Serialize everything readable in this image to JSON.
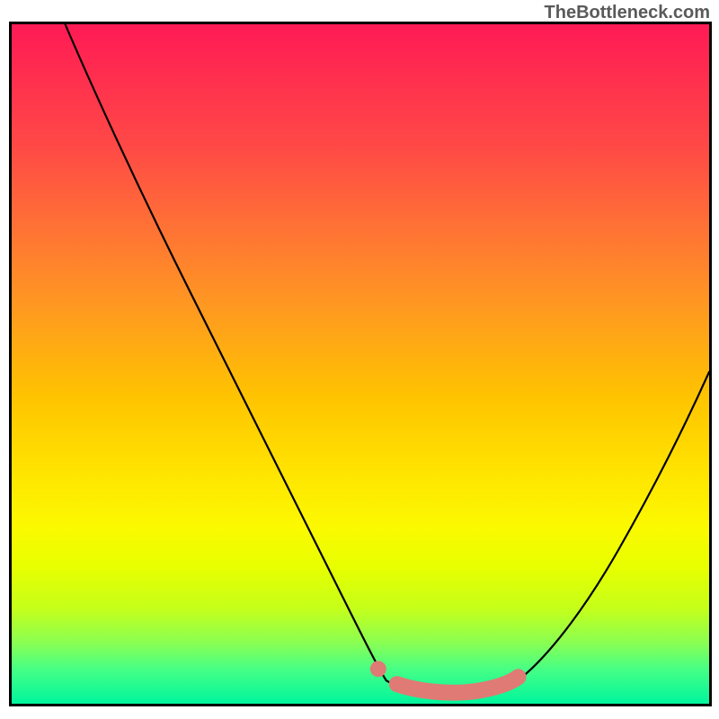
{
  "watermark": "TheBottleneck.com",
  "chart_data": {
    "type": "line",
    "title": "",
    "xlabel": "",
    "ylabel": "",
    "xlim": [
      0,
      100
    ],
    "ylim": [
      0,
      100
    ],
    "series": [
      {
        "name": "curve-main",
        "x": [
          8,
          12,
          20,
          30,
          40,
          48,
          52,
          55,
          58,
          62,
          68,
          72,
          78,
          85,
          92,
          100
        ],
        "values": [
          100,
          92,
          76,
          57,
          38,
          22,
          14,
          8,
          4,
          1,
          1,
          2,
          7,
          18,
          32,
          50
        ]
      }
    ],
    "highlight": {
      "x_start": 52,
      "x_end": 73,
      "note": "optimal-zone"
    },
    "marker_x": 52
  },
  "colors": {
    "gradient_top": "#ff1a55",
    "gradient_bottom": "#00f59d",
    "curve": "#000000",
    "highlight": "#e07a74",
    "frame": "#000000"
  }
}
